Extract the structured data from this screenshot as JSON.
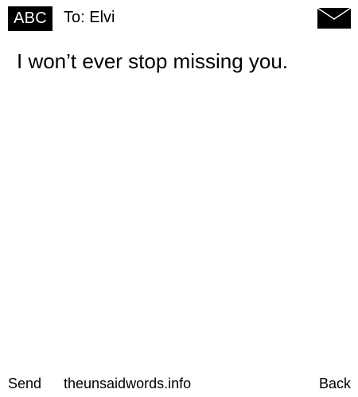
{
  "header": {
    "mode_label": "ABC",
    "recipient": "To: Elvi",
    "envelope_icon": "envelope-icon"
  },
  "message": {
    "text": "I won’t ever stop missing you."
  },
  "footer": {
    "send_label": "Send",
    "site_label": "theunsaidwords.info",
    "back_label": "Back"
  }
}
